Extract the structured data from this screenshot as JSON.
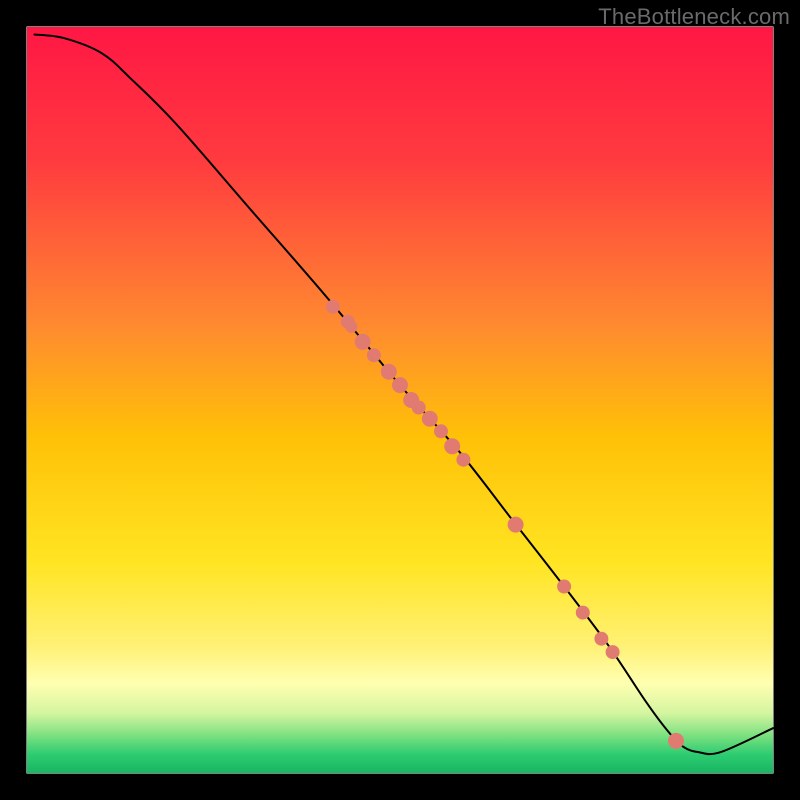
{
  "watermark": "TheBottleneck.com",
  "chart_data": {
    "type": "line",
    "title": "",
    "xlabel": "",
    "ylabel": "",
    "xlim": [
      0,
      100
    ],
    "ylim": [
      0,
      100
    ],
    "gradient_stops": [
      {
        "offset": 0.0,
        "color": "#ff1744"
      },
      {
        "offset": 0.18,
        "color": "#ff3b3f"
      },
      {
        "offset": 0.4,
        "color": "#ff8a30"
      },
      {
        "offset": 0.55,
        "color": "#ffc107"
      },
      {
        "offset": 0.72,
        "color": "#ffe523"
      },
      {
        "offset": 0.83,
        "color": "#fff176"
      },
      {
        "offset": 0.88,
        "color": "#ffffb0"
      },
      {
        "offset": 0.92,
        "color": "#d4f5a0"
      },
      {
        "offset": 0.95,
        "color": "#7be080"
      },
      {
        "offset": 0.975,
        "color": "#2ecc71"
      },
      {
        "offset": 1.0,
        "color": "#18b563"
      }
    ],
    "series": [
      {
        "name": "bottleneck-curve",
        "x": [
          1.0,
          5.0,
          10.0,
          14.0,
          20.0,
          30.0,
          40.0,
          50.0,
          58.0,
          65.0,
          72.0,
          78.0,
          83.0,
          86.0,
          88.0,
          90.0,
          93.0,
          100.0
        ],
        "y": [
          99.0,
          98.5,
          96.5,
          93.0,
          87.0,
          75.5,
          64.0,
          52.0,
          43.0,
          34.0,
          25.0,
          17.0,
          9.5,
          5.5,
          3.5,
          2.8,
          2.8,
          6.0
        ]
      }
    ],
    "markers": {
      "name": "data-points",
      "color": "#e17b71",
      "points": [
        {
          "x": 41.0,
          "y": 62.5,
          "r": 7
        },
        {
          "x": 43.0,
          "y": 60.5,
          "r": 7
        },
        {
          "x": 43.5,
          "y": 59.8,
          "r": 6
        },
        {
          "x": 45.0,
          "y": 57.8,
          "r": 8
        },
        {
          "x": 46.5,
          "y": 56.0,
          "r": 7
        },
        {
          "x": 48.5,
          "y": 53.8,
          "r": 8
        },
        {
          "x": 50.0,
          "y": 52.0,
          "r": 8
        },
        {
          "x": 51.5,
          "y": 50.0,
          "r": 8
        },
        {
          "x": 52.5,
          "y": 49.0,
          "r": 7
        },
        {
          "x": 54.0,
          "y": 47.5,
          "r": 8
        },
        {
          "x": 55.5,
          "y": 45.8,
          "r": 7
        },
        {
          "x": 57.0,
          "y": 43.8,
          "r": 8
        },
        {
          "x": 58.5,
          "y": 42.0,
          "r": 7
        },
        {
          "x": 65.5,
          "y": 33.3,
          "r": 8
        },
        {
          "x": 72.0,
          "y": 25.0,
          "r": 7
        },
        {
          "x": 74.5,
          "y": 21.5,
          "r": 7
        },
        {
          "x": 77.0,
          "y": 18.0,
          "r": 7
        },
        {
          "x": 78.5,
          "y": 16.2,
          "r": 7
        },
        {
          "x": 87.0,
          "y": 4.3,
          "r": 8
        }
      ]
    }
  }
}
